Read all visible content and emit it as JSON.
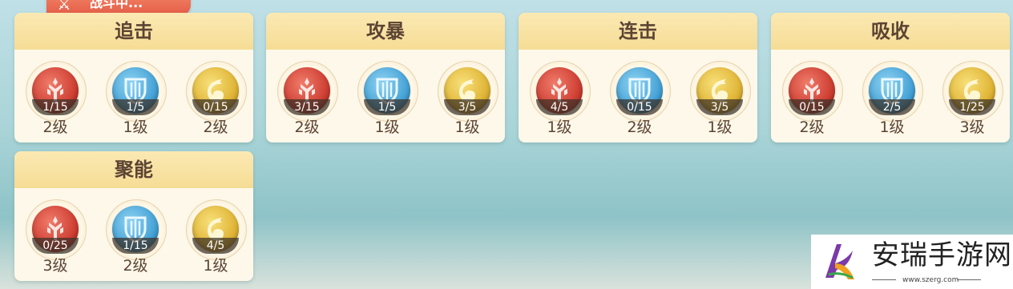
{
  "battle_status": "战斗中...",
  "cards": [
    {
      "title": "追击",
      "skills": [
        {
          "type": "red",
          "icon": "sword-emblem-icon",
          "progress": "1/15",
          "level": "2级"
        },
        {
          "type": "blue",
          "icon": "shield-emblem-icon",
          "progress": "1/5",
          "level": "1级"
        },
        {
          "type": "gold",
          "icon": "flame-emblem-icon",
          "progress": "0/15",
          "level": "2级"
        }
      ]
    },
    {
      "title": "攻暴",
      "skills": [
        {
          "type": "red",
          "icon": "sword-emblem-icon",
          "progress": "3/15",
          "level": "2级"
        },
        {
          "type": "blue",
          "icon": "shield-emblem-icon",
          "progress": "1/5",
          "level": "1级"
        },
        {
          "type": "gold",
          "icon": "flame-emblem-icon",
          "progress": "3/5",
          "level": "1级"
        }
      ]
    },
    {
      "title": "连击",
      "skills": [
        {
          "type": "red",
          "icon": "sword-emblem-icon",
          "progress": "4/5",
          "level": "1级"
        },
        {
          "type": "blue",
          "icon": "shield-emblem-icon",
          "progress": "0/15",
          "level": "2级"
        },
        {
          "type": "gold",
          "icon": "flame-emblem-icon",
          "progress": "3/5",
          "level": "1级"
        }
      ]
    },
    {
      "title": "吸收",
      "skills": [
        {
          "type": "red",
          "icon": "sword-emblem-icon",
          "progress": "0/15",
          "level": "2级"
        },
        {
          "type": "blue",
          "icon": "shield-emblem-icon",
          "progress": "2/5",
          "level": "1级"
        },
        {
          "type": "gold",
          "icon": "flame-emblem-icon",
          "progress": "1/25",
          "level": "3级"
        }
      ]
    },
    {
      "title": "聚能",
      "skills": [
        {
          "type": "red",
          "icon": "sword-emblem-icon",
          "progress": "0/25",
          "level": "3级"
        },
        {
          "type": "blue",
          "icon": "shield-emblem-icon",
          "progress": "1/15",
          "level": "2级"
        },
        {
          "type": "gold",
          "icon": "flame-emblem-icon",
          "progress": "4/5",
          "level": "1级"
        }
      ]
    }
  ],
  "watermark": {
    "name": "安瑞手游网",
    "url": "www.szerg.com"
  },
  "colors": {
    "card_header": "#f6dc95",
    "card_body": "#fdf8e9",
    "title_text": "#5c4434",
    "tag_bg": "#e45b46"
  }
}
